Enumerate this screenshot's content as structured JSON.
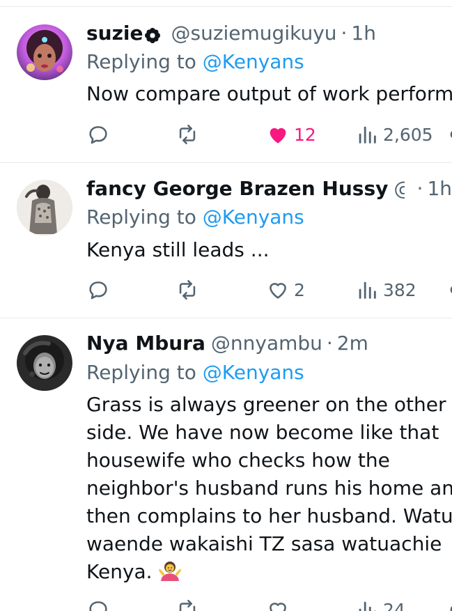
{
  "tweets": [
    {
      "display_name": "suzie",
      "handle": "@suziemugikuyu",
      "separator": "·",
      "time": "1h",
      "reply_label": "Replying to",
      "reply_target": "@Kenyans",
      "text": "Now compare output of work perform",
      "actions": {
        "reply_count": "",
        "retweet_count": "",
        "like_count": "12",
        "view_count": "2,605"
      },
      "liked": true
    },
    {
      "display_name": "fancy George Brazen Hussy",
      "handle": "@F...",
      "separator": "·",
      "time": "1h",
      "reply_label": "Replying to",
      "reply_target": "@Kenyans",
      "text": "Kenya still leads ...",
      "actions": {
        "reply_count": "",
        "retweet_count": "",
        "like_count": "2",
        "view_count": "382"
      },
      "liked": false
    },
    {
      "display_name": "Nya Mbura",
      "handle": "@nnyambu",
      "separator": "·",
      "time": "2m",
      "reply_label": "Replying to",
      "reply_target": "@Kenyans",
      "text_lines": [
        "Grass is always greener on the other",
        "side. We have now become like that",
        "housewife who checks how the",
        "neighbor's husband runs his home and",
        "then complains to her husband. Watu",
        "waende wakaishi TZ sasa watuachie",
        "Kenya."
      ],
      "actions": {
        "reply_count": "",
        "retweet_count": "",
        "like_count": "",
        "view_count": "24"
      },
      "liked": false
    }
  ],
  "colors": {
    "text": "#0f1419",
    "secondary": "#536471",
    "link": "#1d9bf0",
    "like": "#f91880",
    "divider": "#e6e9ec"
  },
  "icons": {
    "reply": "reply-icon",
    "retweet": "retweet-icon",
    "like": "heart-icon",
    "views": "views-icon",
    "share": "share-icon"
  }
}
